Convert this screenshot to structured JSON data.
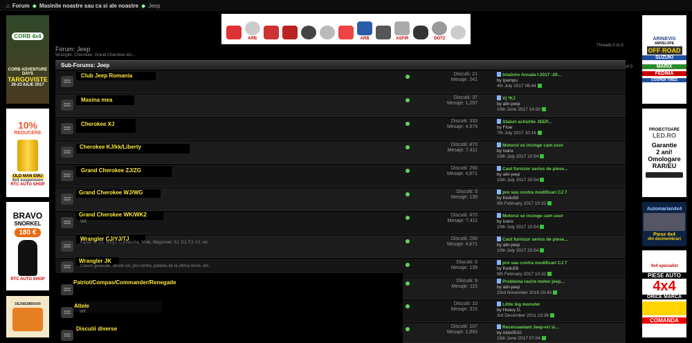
{
  "breadcrumb": [
    "Forum",
    "Masinile noastre sau ca si ale noastre",
    "Jeep"
  ],
  "forum": {
    "title": "Forum: Jeep",
    "description": "Wrangler, Cherokee, Grand Cherokee etc..."
  },
  "misc": {
    "threads_of": "Threads 0 to 0",
    "of_label": "of 0"
  },
  "subforums_header": "Sub-Forums: Jeep",
  "banner_items": [
    "",
    "ARB",
    "",
    "",
    "",
    "",
    "",
    "ARB",
    "",
    "ASFIR",
    "",
    "DOTZ",
    ""
  ],
  "ads_left": [
    {
      "lines": [
        "CORB 4x4",
        "CORB ADVENTURE",
        "DAYS",
        "TARGOVISTE",
        "20-23 IULIE 2017"
      ]
    },
    {
      "lines": [
        "10%",
        "REDUCERE",
        "OLD MAN EMU",
        "4x4 suspension",
        "RTC AUTO SHOP"
      ]
    },
    {
      "lines": [
        "BRAVO",
        "SNORKEL",
        "180 €",
        "RTC AUTO SHOP"
      ]
    },
    {
      "lines": [
        "DEZMEMBRARI"
      ]
    }
  ],
  "ads_right": [
    {
      "lines": [
        "ARINEVIS",
        "AMVELOPE",
        "OFF ROAD",
        "SUZUKI",
        "MARIX",
        "FEDIMA",
        "COOPER TIRES"
      ]
    },
    {
      "lines": [
        "PROIECTOARE",
        "LED.RO",
        "Garantie",
        "2 ani!",
        "Omologare",
        "RAR/EU"
      ]
    },
    {
      "lines": [
        "Automarian4x4",
        "Piese 4x4",
        "din dezmembrari"
      ]
    },
    {
      "lines": [
        "4x4 specialist",
        "PIESE AUTO",
        "4x4",
        "ORICE MARCA",
        "COMANDA"
      ]
    }
  ],
  "subforums": [
    {
      "name": "Club Jeep Romania",
      "desc": "",
      "threads": "Discutii: 21",
      "posts": "Mesaje: 241",
      "last_title": "Intalnire Anuala I 2017 -29...",
      "last_by": "by ipampu",
      "last_date": "4th July 2017 06:44"
    },
    {
      "name": "Masina mea",
      "desc": "",
      "threads": "Discutii: 37",
      "posts": "Mesaje: 1,257",
      "last_title": "Vj *KJ",
      "last_by": "by alin-jeep",
      "last_date": "10th June 2017 14:20"
    },
    {
      "name": "Cherokee XJ",
      "desc": "",
      "threads": "Discutii: 333",
      "posts": "Mesaje: 4,979",
      "last_title": "Staturi achizitie JEEP...",
      "last_by": "by Flow",
      "last_date": "7th July 2017 10:16"
    },
    {
      "name": "Cherokee KJ/kk/Liberty",
      "desc": "",
      "threads": "Discutii: 470",
      "posts": "Mesaje: 7,411",
      "last_title": "Motorul se incinge cam usor",
      "last_by": "by ivanx",
      "last_date": "10th July 2017 10:54"
    },
    {
      "name": "Grand Cherokee ZJ/ZG",
      "desc": "",
      "threads": "Discutii: 290",
      "posts": "Mesaje: 4,871",
      "last_title": "Caut furnizor serios de piese...",
      "last_by": "by alin-jeep",
      "last_date": "10th July 2017 20:54"
    },
    {
      "name": "Grand Cherokee WJ/WG",
      "desc": "",
      "threads": "Discutii: 5",
      "posts": "Mesaje: 139",
      "last_title": "pro sau contra modificari CJ 7",
      "last_by": "by Kedu58",
      "last_date": "9th February 2017 10:32"
    },
    {
      "name": "Grand Cherokee WK/WK2",
      "desc": "WK",
      "threads": "Discutii: 470",
      "posts": "Mesaje: 7,411",
      "last_title": "Motorul se incinge cam usor",
      "last_by": "by ivanx",
      "last_date": "10th July 2017 10:54"
    },
    {
      "name": "Wrangler CJ/YJ/TJ",
      "desc": "Kaiser M715, Willys, Comanche, Mule, Wagoneer, SJ, DJ, FJ, VJ, etc.",
      "threads": "Discutii: 290",
      "posts": "Mesaje: 4,871",
      "last_title": "Caut furnizor serios de piese...",
      "last_by": "by alin-jeep",
      "last_date": "10th July 2017 20:54"
    },
    {
      "name": "Wrangler JK",
      "desc": "Chestii generale, whists-ori, pro-contra, patania de la ultima iesire, etc.",
      "threads": "Discutii: 5",
      "posts": "Mesaje: 139",
      "last_title": "pro sau contra modificari CJ 7",
      "last_by": "by Kedu58",
      "last_date": "9th February 2017 10:32"
    },
    {
      "name": "Patriot/Compas/Commander/Renegade",
      "desc": "",
      "threads": "Discutii: 9",
      "posts": "Mesaje: 115",
      "last_title": "Problema racire motor jeep...",
      "last_by": "by alin-jeep",
      "last_date": "23rd November 2016 20:43"
    },
    {
      "name": "Altele",
      "desc": "WK",
      "threads": "Discutii: 10",
      "posts": "Mesaje: 315",
      "last_title": "Little big monster",
      "last_by": "by Heavy D.",
      "last_date": "3rd December 2011 23:36"
    },
    {
      "name": "Discutii diverse",
      "desc": "",
      "threads": "Discutii: 107",
      "posts": "Mesaje: 1,993",
      "last_title": "Recensamant Jeep-eri si...",
      "last_by": "by Aldo0510",
      "last_date": "15th June 2017 07:04"
    }
  ]
}
